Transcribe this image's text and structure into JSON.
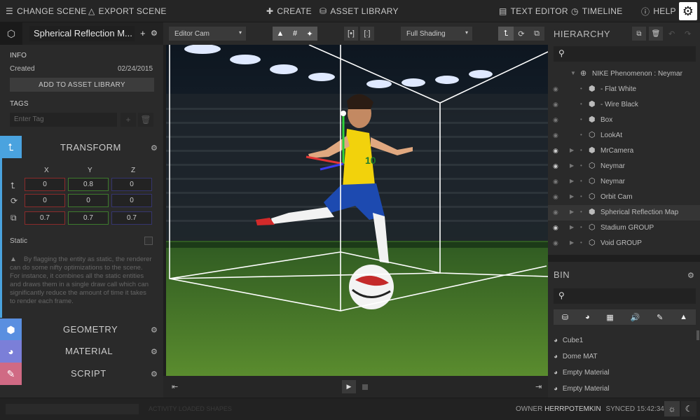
{
  "topbar": {
    "change_scene": "CHANGE SCENE",
    "export_scene": "EXPORT SCENE",
    "create": "CREATE",
    "asset_library": "ASSET LIBRARY",
    "text_editor": "TEXT EDITOR",
    "timeline": "TIMELINE",
    "help": "HELP"
  },
  "entity": {
    "name": "Spherical Reflection M..."
  },
  "info": {
    "title": "INFO",
    "created_label": "Created",
    "created_value": "02/24/2015",
    "add_to_library": "ADD TO ASSET LIBRARY",
    "tags_title": "TAGS",
    "tag_placeholder": "Enter Tag"
  },
  "transform": {
    "title": "TRANSFORM",
    "x": "X",
    "y": "Y",
    "z": "Z",
    "position": [
      "0",
      "0.8",
      "0"
    ],
    "rotation": [
      "0",
      "0",
      "0"
    ],
    "scale": [
      "0.7",
      "0.7",
      "0.7"
    ],
    "static_label": "Static",
    "static_desc": "By flagging the entity as static, the renderer can do some nifty optimizations to the scene. For instance, it combines all the static entities and draws them in a single draw call which can significantly reduce the amount of time it takes to render each frame."
  },
  "components": {
    "geometry": "GEOMETRY",
    "material": "MATERIAL",
    "script": "SCRIPT"
  },
  "viewport_toolbar": {
    "camera": "Editor Cam",
    "shading": "Full Shading"
  },
  "hierarchy": {
    "title": "HIERARCHY",
    "root": "NIKE Phenomenon : Neymar",
    "items": [
      {
        "label": "- Flat White"
      },
      {
        "label": "- Wire Black"
      },
      {
        "label": "Box"
      },
      {
        "label": "LookAt"
      },
      {
        "label": "MrCamera"
      },
      {
        "label": "Neymar"
      },
      {
        "label": "Neymar"
      },
      {
        "label": "Orbit Cam"
      },
      {
        "label": "Spherical Reflection Map"
      },
      {
        "label": "Stadium GROUP"
      },
      {
        "label": "Void GROUP"
      }
    ]
  },
  "bin": {
    "title": "BIN",
    "items": [
      {
        "label": "Cube1"
      },
      {
        "label": "Dome MAT"
      },
      {
        "label": "Empty Material"
      },
      {
        "label": "Empty Material"
      }
    ]
  },
  "status": {
    "message": "ACTIVITY LOADED SHAPES",
    "owner_label": "OWNER",
    "owner": "HERRPOTEMKIN",
    "synced": "SYNCED 15:42:34"
  },
  "colors": {
    "transform_accent": "#4aa3df",
    "geometry_accent": "#5a8fe0",
    "material_accent": "#7b7fd8",
    "script_accent": "#d06a84"
  }
}
